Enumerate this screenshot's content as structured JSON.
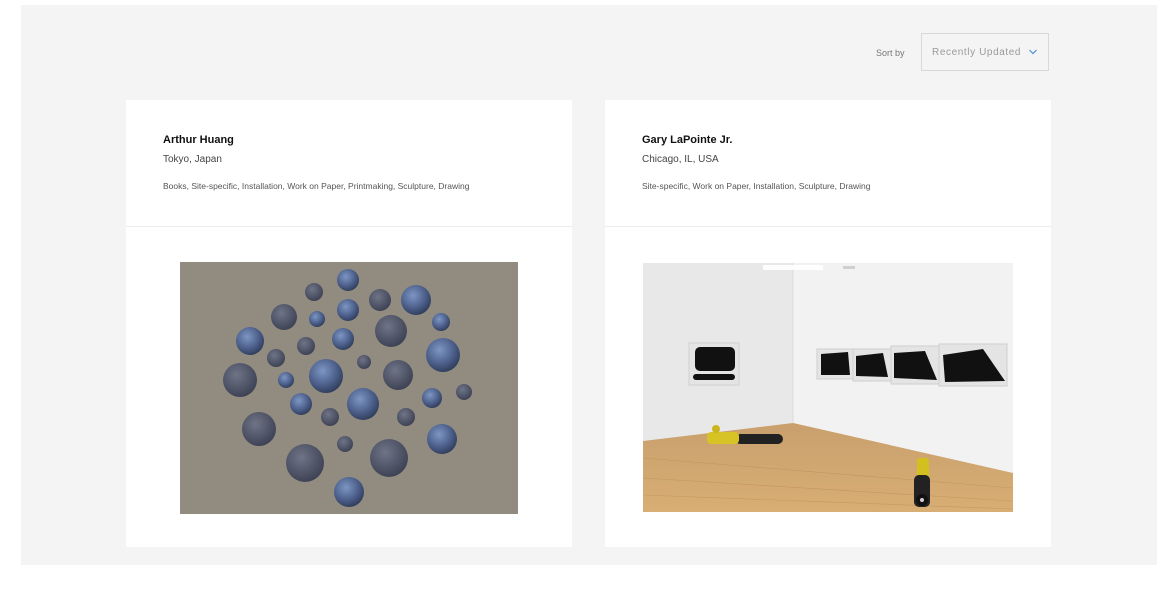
{
  "sort": {
    "label": "Sort by",
    "selected": "Recently Updated"
  },
  "artists": [
    {
      "name": "Arthur Huang",
      "location": "Tokyo, Japan",
      "media": "Books, Site-specific, Installation, Work on Paper, Printmaking, Sculpture, Drawing",
      "image_icon": "mirror-circles-installation"
    },
    {
      "name": "Gary LaPointe Jr.",
      "location": "Chicago, IL, USA",
      "media": "Site-specific, Work on Paper, Installation, Sculpture, Drawing",
      "image_icon": "gallery-installation"
    }
  ],
  "colors": {
    "panel_bg": "#f4f4f4",
    "card_bg": "#ffffff",
    "accent": "#4a8fd6"
  }
}
